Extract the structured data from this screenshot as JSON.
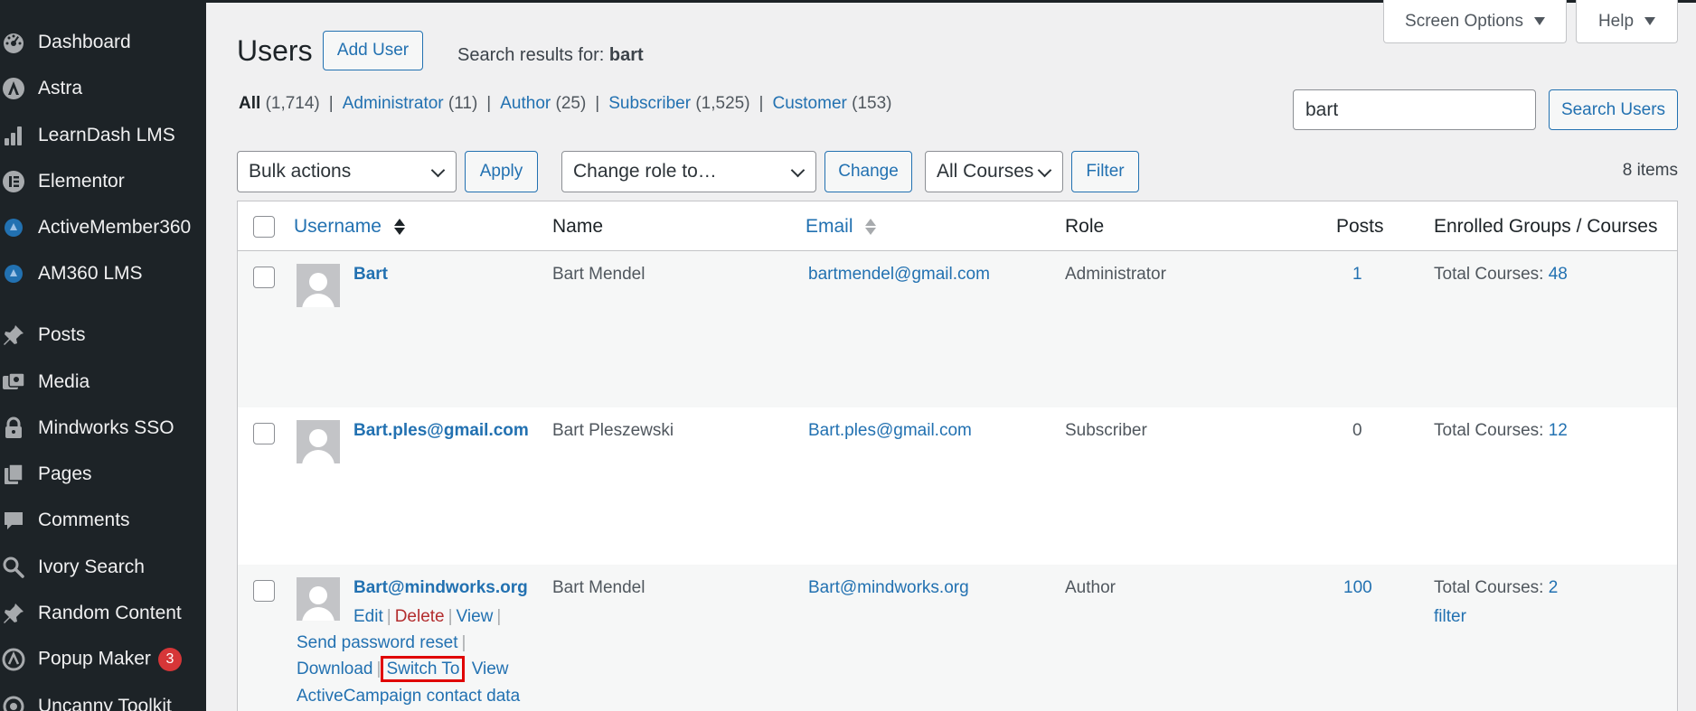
{
  "sidebar": {
    "items": [
      {
        "label": "Dashboard",
        "icon": "dashboard-icon"
      },
      {
        "label": "Astra",
        "icon": "astra-icon"
      },
      {
        "label": "LearnDash LMS",
        "icon": "bar-chart-icon"
      },
      {
        "label": "Elementor",
        "icon": "elementor-icon"
      },
      {
        "label": "ActiveMember360",
        "icon": "activemember-icon"
      },
      {
        "label": "AM360 LMS",
        "icon": "activemember-icon"
      },
      {
        "label": "Posts",
        "icon": "pushpin-icon"
      },
      {
        "label": "Media",
        "icon": "media-icon"
      },
      {
        "label": "Mindworks SSO",
        "icon": "lock-icon"
      },
      {
        "label": "Pages",
        "icon": "pages-icon"
      },
      {
        "label": "Comments",
        "icon": "comment-icon"
      },
      {
        "label": "Ivory Search",
        "icon": "search-icon"
      },
      {
        "label": "Random Content",
        "icon": "pushpin-icon"
      },
      {
        "label": "Popup Maker",
        "icon": "popup-icon",
        "badge": "3"
      },
      {
        "label": "Uncanny Toolkit",
        "icon": "uncanny-icon"
      }
    ]
  },
  "header": {
    "title": "Users",
    "add_user": "Add User",
    "search_prefix": "Search results for:",
    "search_term": "bart",
    "screen_options": "Screen Options",
    "help": "Help"
  },
  "filters": [
    {
      "label": "All",
      "count": "(1,714)",
      "current": true
    },
    {
      "label": "Administrator",
      "count": "(11)"
    },
    {
      "label": "Author",
      "count": "(25)"
    },
    {
      "label": "Subscriber",
      "count": "(1,525)"
    },
    {
      "label": "Customer",
      "count": "(153)"
    }
  ],
  "search": {
    "value": "bart",
    "button": "Search Users"
  },
  "toolbar": {
    "bulk_actions": "Bulk actions",
    "apply": "Apply",
    "change_role": "Change role to…",
    "change": "Change",
    "courses": "All Courses",
    "filter": "Filter",
    "items_count": "8 items"
  },
  "table": {
    "columns": {
      "username": "Username",
      "name": "Name",
      "email": "Email",
      "role": "Role",
      "posts": "Posts",
      "enrolled": "Enrolled Groups / Courses"
    },
    "rows": [
      {
        "username": "Bart",
        "name": "Bart Mendel",
        "email": "bartmendel@gmail.com",
        "role": "Administrator",
        "posts": "1",
        "courses_label": "Total Courses:",
        "courses_count": "48"
      },
      {
        "username": "Bart.ples@gmail.com",
        "name": "Bart Pleszewski",
        "email": "Bart.ples@gmail.com",
        "role": "Subscriber",
        "posts": "0",
        "courses_label": "Total Courses:",
        "courses_count": "12"
      },
      {
        "username": "Bart@mindworks.org",
        "name": "Bart Mendel",
        "email": "Bart@mindworks.org",
        "role": "Author",
        "posts": "100",
        "courses_label": "Total Courses:",
        "courses_count": "2",
        "extra": "filter"
      }
    ],
    "row_actions": {
      "edit": "Edit",
      "delete": "Delete",
      "view": "View",
      "send_reset": "Send password reset",
      "download": "Download",
      "switch_to": "Switch To",
      "view2": "View",
      "activecampaign": "ActiveCampaign contact data"
    }
  },
  "colors": {
    "sidebar_bg": "#1d2327",
    "link": "#2271b1",
    "delete": "#b32d2e",
    "badge": "#d63638",
    "highlight": "#e00000"
  }
}
